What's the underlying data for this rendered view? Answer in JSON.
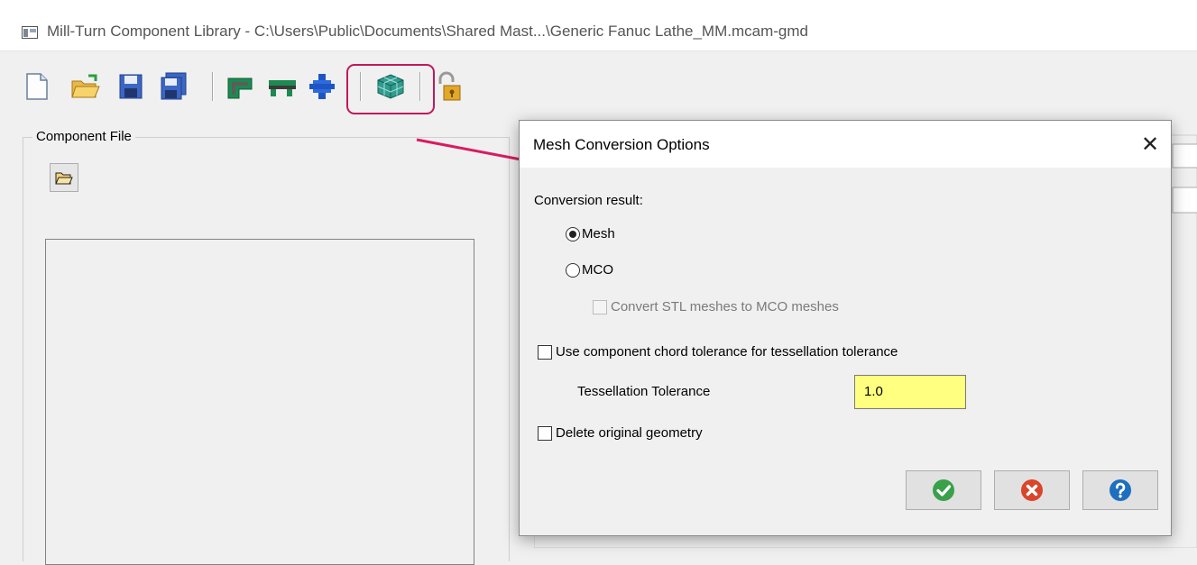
{
  "window": {
    "title": "Mill-Turn Component Library - C:\\Users\\Public\\Documents\\Shared Mast...\\Generic Fanuc Lathe_MM.mcam-gmd"
  },
  "toolbar": {
    "buttons": [
      "new-file-icon",
      "open-folder-icon",
      "save-icon",
      "save-as-icon",
      "component-green-icon",
      "component-stripe-icon",
      "component-blue-icon",
      "mesh-conversion-icon",
      "lock-icon"
    ]
  },
  "left_panel": {
    "group_label": "Component File"
  },
  "dialog": {
    "title": "Mesh Conversion Options",
    "close_glyph": "✕",
    "conversion_result_label": "Conversion result:",
    "option_mesh": "Mesh",
    "option_mco": "MCO",
    "convert_stl_label": "Convert STL meshes to MCO meshes",
    "use_chord_label": "Use component chord tolerance for tessellation tolerance",
    "tessellation_label": "Tessellation Tolerance",
    "tessellation_value": "1.0",
    "delete_original_label": "Delete original geometry",
    "selected_option": "Mesh",
    "ok_icon": "check-icon",
    "cancel_icon": "cancel-icon",
    "help_icon": "help-icon"
  },
  "colors": {
    "highlight": "#c2185b",
    "input_bg": "#ffff80",
    "ok_green": "#3aa04a",
    "cancel_red": "#d9452b",
    "help_blue": "#1e6fbf"
  }
}
